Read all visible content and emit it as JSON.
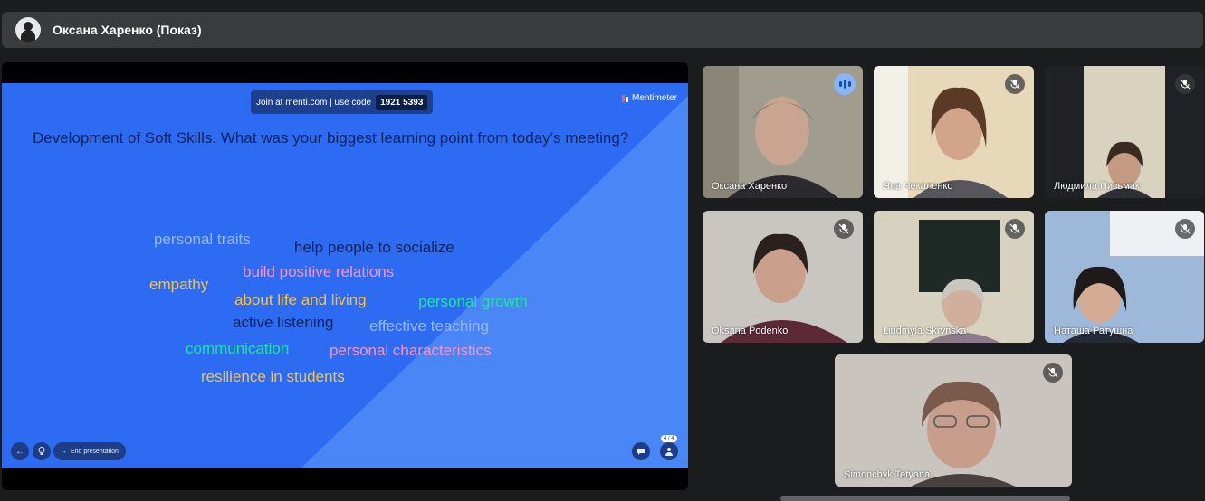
{
  "presenter": {
    "title": "Оксана Харенко (Показ)"
  },
  "slide": {
    "join_text": "Join at menti.com | use code",
    "join_code": "1921 5393",
    "brand": "Mentimeter",
    "question": "Development of Soft Skills. What was your biggest learning point from today’s meeting?",
    "words": [
      {
        "text": "personal traits",
        "color": "#9fb6ec"
      },
      {
        "text": "help people to socialize",
        "color": "#10235a"
      },
      {
        "text": "build positive relations",
        "color": "#ff93c9"
      },
      {
        "text": "empathy",
        "color": "#f9c34a"
      },
      {
        "text": "about life and living",
        "color": "#f9c34a"
      },
      {
        "text": "personal growth",
        "color": "#1ee59f"
      },
      {
        "text": "active listening",
        "color": "#10235a"
      },
      {
        "text": "effective teaching",
        "color": "#9fb6ec"
      },
      {
        "text": "communication",
        "color": "#1ee59f"
      },
      {
        "text": "personal characteristics",
        "color": "#ff93c9"
      },
      {
        "text": "resilience in students",
        "color": "#f9c34a"
      }
    ],
    "end_label": "End presentation",
    "counter": "4 / 4"
  },
  "participants": [
    {
      "name": "Оксана Харенко",
      "speaking": true
    },
    {
      "name": "Яна Чекаленко",
      "speaking": false
    },
    {
      "name": "Людмила Письмак",
      "speaking": false
    },
    {
      "name": "Oksana Podenko",
      "speaking": false
    },
    {
      "name": "Liudmyla Skrynska",
      "speaking": false
    },
    {
      "name": "Наташа Ратушна",
      "speaking": false
    },
    {
      "name": "Simonchyk Tetyana",
      "speaking": false
    }
  ],
  "colors": {
    "accent": "#8ab4f8",
    "slide_bg": "#2c6bf2"
  }
}
